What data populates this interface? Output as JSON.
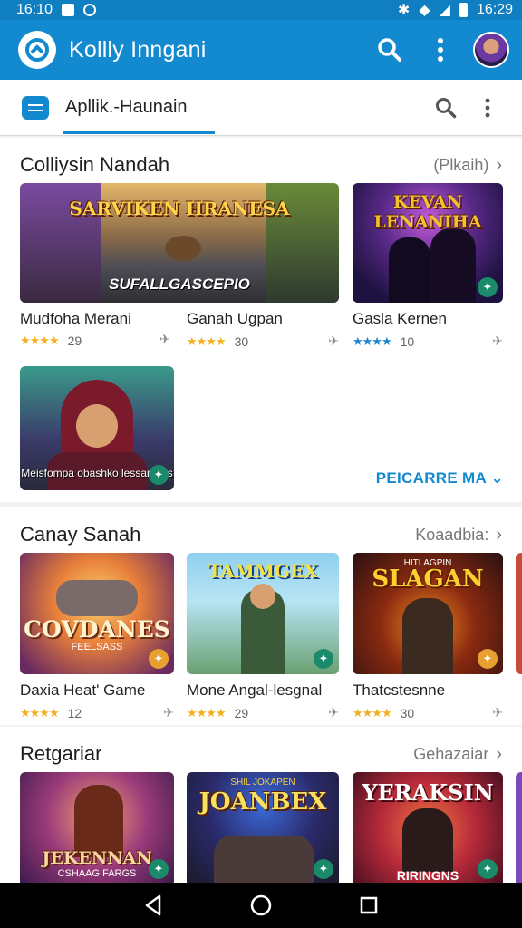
{
  "status": {
    "time_left": "16:10",
    "time_right": "16:29"
  },
  "app": {
    "title": "Kollly Inngani"
  },
  "tabs": {
    "active_label": "Apllik.-Haunain"
  },
  "sections": [
    {
      "title": "Colliysin Nandah",
      "more": "(Plkaih)",
      "cards": [
        {
          "title": "Mudfoha Merani",
          "rating": "29",
          "art_text": "SARVIKEN HRANESA",
          "art_subtext": "SUFALLGASCEPIO"
        },
        {
          "title": "Ganah Ugpan",
          "rating": "30"
        },
        {
          "title": "Gasla Kernen",
          "rating": "10",
          "art_text": "KEVAN LENANIHA"
        },
        {
          "title": "",
          "rating": "",
          "art_text": "Meisfompa obashko lessarcess"
        }
      ],
      "expand_label": "PEICARRE MA"
    },
    {
      "title": "Canay Sanah",
      "more": "Koaadbia:",
      "cards": [
        {
          "title": "Daxia Heat' Game",
          "rating": "12",
          "art_text": "COVDANES",
          "art_subtext": "FEELSASS"
        },
        {
          "title": "Mone Angal-lesgnal",
          "rating": "29",
          "art_text": "TAMMGEX"
        },
        {
          "title": "Thatcstesnne",
          "rating": "30",
          "art_text": "SLAGAN",
          "art_subtext": "HITLAGPIN"
        }
      ]
    },
    {
      "title": "Retgariar",
      "more": "Gehazaiar",
      "cards": [
        {
          "art_text": "JEKENNAN",
          "art_subtext": "CSHAAG FARGS"
        },
        {
          "art_text": "JOANBEX",
          "art_subtext": "SHIL JOKAPEN"
        },
        {
          "art_text": "YERAKSIN",
          "art_subtext": "RIRINGNS"
        }
      ]
    }
  ],
  "colors": {
    "primary": "#1389cf",
    "star": "#f2b01e",
    "badge": "#1a8a6a"
  }
}
